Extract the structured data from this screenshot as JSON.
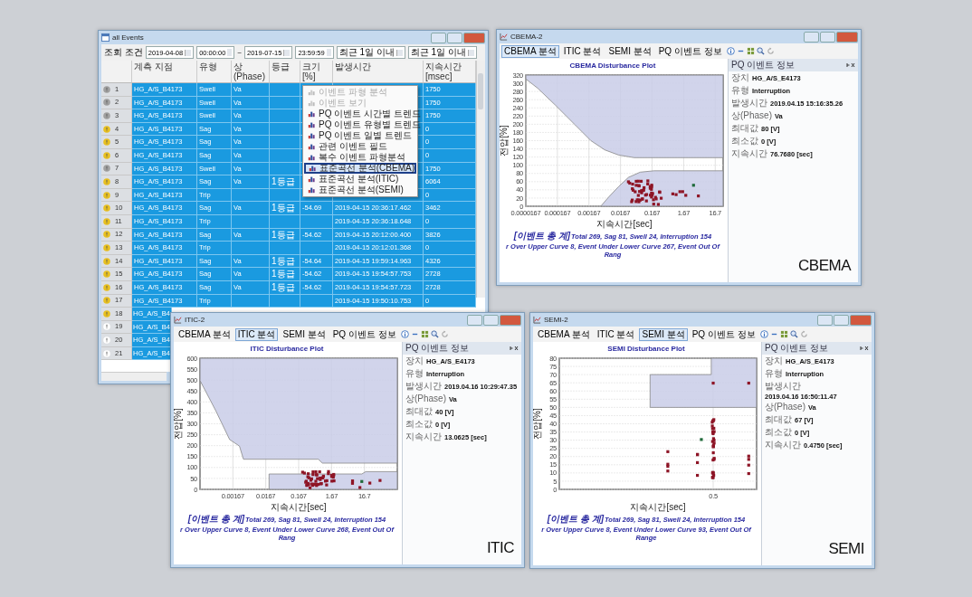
{
  "main_window": {
    "title": "all Events",
    "toolbar": {
      "label": "조회 조건",
      "start_date": "2019-04-08",
      "start_time": "00:00:00",
      "separator": "~",
      "end_date": "2019-07-15",
      "end_time": "23:59:59",
      "filter_1": "최근 1일 이내",
      "filter_2": "최근 1일 이내"
    },
    "columns": [
      "계측 지점",
      "유형",
      "상(Phase)",
      "등급",
      "크기[%]",
      "발생시간",
      "지속시간[msec]"
    ],
    "rows": [
      {
        "num": "1",
        "name": "HG_A/S_B4173",
        "type": "Swell",
        "phase": "Va",
        "grade": "",
        "size": "",
        "time": "",
        "duration": "1750",
        "color": "#a0a0a0"
      },
      {
        "num": "2",
        "name": "HG_A/S_B4173",
        "type": "Swell",
        "phase": "Va",
        "grade": "",
        "size": "",
        "time": "",
        "duration": "1750",
        "color": "#a0a0a0"
      },
      {
        "num": "3",
        "name": "HG_A/S_B4173",
        "type": "Swell",
        "phase": "Va",
        "grade": "",
        "size": "",
        "time": "",
        "duration": "1750",
        "color": "#a0a0a0"
      },
      {
        "num": "4",
        "name": "HG_A/S_B4173",
        "type": "Sag",
        "phase": "Va",
        "grade": "",
        "size": "",
        "time": "",
        "duration": "0",
        "color": "#e8c020"
      },
      {
        "num": "5",
        "name": "HG_A/S_B4173",
        "type": "Sag",
        "phase": "Va",
        "grade": "",
        "size": "",
        "time": "",
        "duration": "0",
        "color": "#e8c020"
      },
      {
        "num": "6",
        "name": "HG_A/S_B4173",
        "type": "Sag",
        "phase": "Va",
        "grade": "",
        "size": "",
        "time": "",
        "duration": "0",
        "color": "#e8c020"
      },
      {
        "num": "7",
        "name": "HG_A/S_B4173",
        "type": "Swell",
        "phase": "Va",
        "grade": "",
        "size": "",
        "time": "",
        "duration": "1750",
        "color": "#a0a0a0"
      },
      {
        "num": "8",
        "name": "HG_A/S_B4173",
        "type": "Sag",
        "phase": "Va",
        "grade": "1등급",
        "size": "",
        "time": "",
        "duration": "6064",
        "color": "#e8c020"
      },
      {
        "num": "9",
        "name": "HG_A/S_B4173",
        "type": "Trip",
        "phase": "",
        "grade": "",
        "size": "",
        "time": "",
        "duration": "0",
        "color": "#e8c020"
      },
      {
        "num": "10",
        "name": "HG_A/S_B4173",
        "type": "Sag",
        "phase": "Va",
        "grade": "1등급",
        "size": "-54.69",
        "time": "2019-04-15 20:36:17.462",
        "duration": "3462",
        "color": "#e8c020"
      },
      {
        "num": "11",
        "name": "HG_A/S_B4173",
        "type": "Trip",
        "phase": "",
        "grade": "",
        "size": "",
        "time": "2019-04-15 20:36:18.648",
        "duration": "0",
        "color": "#e8c020"
      },
      {
        "num": "12",
        "name": "HG_A/S_B4173",
        "type": "Sag",
        "phase": "Va",
        "grade": "1등급",
        "size": "-54.62",
        "time": "2019-04-15 20:12:00.400",
        "duration": "3826",
        "color": "#e8c020"
      },
      {
        "num": "13",
        "name": "HG_A/S_B4173",
        "type": "Trip",
        "phase": "",
        "grade": "",
        "size": "",
        "time": "2019-04-15 20:12:01.368",
        "duration": "0",
        "color": "#e8c020"
      },
      {
        "num": "14",
        "name": "HG_A/S_B4173",
        "type": "Sag",
        "phase": "Va",
        "grade": "1등급",
        "size": "-54.64",
        "time": "2019-04-15 19:59:14.963",
        "duration": "4326",
        "color": "#e8c020"
      },
      {
        "num": "15",
        "name": "HG_A/S_B4173",
        "type": "Sag",
        "phase": "Va",
        "grade": "1등급",
        "size": "-54.62",
        "time": "2019-04-15 19:54:57.753",
        "duration": "2728",
        "color": "#e8c020"
      },
      {
        "num": "16",
        "name": "HG_A/S_B4173",
        "type": "Sag",
        "phase": "Va",
        "grade": "1등급",
        "size": "-54.62",
        "time": "2019-04-15 19:54:57.723",
        "duration": "2728",
        "color": "#e8c020"
      },
      {
        "num": "17",
        "name": "HG_A/S_B4173",
        "type": "Trip",
        "phase": "",
        "grade": "",
        "size": "",
        "time": "2019-04-15 19:50:10.753",
        "duration": "0",
        "color": "#e8c020"
      },
      {
        "num": "18",
        "name": "HG_A/S_B4",
        "color": "#e8c020"
      },
      {
        "num": "19",
        "name": "HG_A/S_B4",
        "color": "#ffffff"
      },
      {
        "num": "20",
        "name": "HG_A/S_B4",
        "color": "#ffffff"
      },
      {
        "num": "21",
        "name": "HG_A/S_B4",
        "color": "#ffffff"
      }
    ],
    "context_menu": [
      {
        "label": "이벤트 파형 분석",
        "disabled": true,
        "selected": false
      },
      {
        "label": "이벤트 보기",
        "disabled": true,
        "selected": false
      },
      {
        "label": "PQ 이벤트 시간별 트렌드",
        "disabled": false,
        "selected": false
      },
      {
        "label": "PQ 이벤트 유형별 트렌드",
        "disabled": false,
        "selected": false
      },
      {
        "label": "PQ 이벤트 일별 트렌드",
        "disabled": false,
        "selected": false
      },
      {
        "label": "관련 이벤트 필드",
        "disabled": false,
        "selected": false
      },
      {
        "label": "복수 이벤트 파형분석",
        "disabled": false,
        "selected": false
      },
      {
        "label": "표준곡선 분석(CBEMA)",
        "disabled": false,
        "selected": true
      },
      {
        "label": "표준곡선 분석(ITIC)",
        "disabled": false,
        "selected": false
      },
      {
        "label": "표준곡선 분석(SEMI)",
        "disabled": false,
        "selected": false
      }
    ]
  },
  "plot_windows": [
    {
      "kind": "cbema",
      "title": "CBEMA-2",
      "tabs": [
        {
          "label": "CBEMA 분석",
          "selected": true
        },
        {
          "label": "ITIC 분석",
          "selected": false
        },
        {
          "label": "SEMI 분석",
          "selected": false
        },
        {
          "label": "PQ 이벤트 정보",
          "selected": false
        }
      ],
      "chart_title": "CBEMA Disturbance Plot",
      "y_label": "전압[%]",
      "x_label": "지속시간[sec]",
      "y_ticks": [
        "320",
        "300",
        "280",
        "260",
        "240",
        "220",
        "200",
        "180",
        "160",
        "140",
        "120",
        "100",
        "80",
        "60",
        "40",
        "20",
        "0"
      ],
      "x_ticks": [
        "0.0000167",
        "0.000167",
        "0.00167",
        "0.0167",
        "0.167",
        "1.67",
        "16.7"
      ],
      "summary_label": "[이벤트 총 계]",
      "summary": "Total 269, Sag 81, Swell 24, Interruption 154",
      "footer": "r Over Upper Curve 8, Event Under Lower Curve 267, Event Out Of Rang",
      "info_header": "PQ 이벤트 정보",
      "info": [
        {
          "label": "장치",
          "value": "HG_A/S_E4173"
        },
        {
          "label": "유형",
          "value": "Interruption"
        },
        {
          "label": "발생시간",
          "value": "2019.04.15 15:16:35.26"
        },
        {
          "label": "상(Phase)",
          "value": "Va"
        },
        {
          "label": "최대값",
          "value": "80 [V]"
        },
        {
          "label": "최소값",
          "value": "0 [V]"
        },
        {
          "label": "지속시간",
          "value": "76.7680 [sec]"
        }
      ],
      "badge": "CBEMA"
    },
    {
      "kind": "itic",
      "title": "ITIC-2",
      "tabs": [
        {
          "label": "CBEMA 분석",
          "selected": false
        },
        {
          "label": "ITIC 분석",
          "selected": true
        },
        {
          "label": "SEMI 분석",
          "selected": false
        },
        {
          "label": "PQ 이벤트 정보",
          "selected": false
        }
      ],
      "chart_title": "ITIC Disturbance Plot",
      "y_label": "전압[%]",
      "x_label": "지속시간[sec]",
      "y_ticks": [
        "600",
        "550",
        "500",
        "450",
        "400",
        "350",
        "300",
        "250",
        "200",
        "150",
        "100",
        "50",
        "0"
      ],
      "x_ticks": [
        "0.00167",
        "0.0167",
        "0.167",
        "1.67",
        "16.7"
      ],
      "summary_label": "[이벤트 총 계]",
      "summary": "Total 269, Sag 81, Swell 24, Interruption 154",
      "footer": "r Over Upper Curve 8, Event Under Lower Curve 268, Event Out Of Rang",
      "info_header": "PQ 이벤트 정보",
      "info": [
        {
          "label": "장치",
          "value": "HG_A/S_E4173"
        },
        {
          "label": "유형",
          "value": "Interruption"
        },
        {
          "label": "발생시간",
          "value": "2019.04.16 10:29:47.35"
        },
        {
          "label": "상(Phase)",
          "value": "Va"
        },
        {
          "label": "최대값",
          "value": "40 [V]"
        },
        {
          "label": "최소값",
          "value": "0 [V]"
        },
        {
          "label": "지속시간",
          "value": "13.0625 [sec]"
        }
      ],
      "badge": "ITIC"
    },
    {
      "kind": "semi",
      "title": "SEMI-2",
      "tabs": [
        {
          "label": "CBEMA 분석",
          "selected": false
        },
        {
          "label": "ITIC 분석",
          "selected": false
        },
        {
          "label": "SEMI 분석",
          "selected": true
        },
        {
          "label": "PQ 이벤트 정보",
          "selected": false
        }
      ],
      "chart_title": "SEMI Disturbance Plot",
      "y_label": "전압[%]",
      "x_label": "지속시간[sec]",
      "y_ticks": [
        "80",
        "75",
        "70",
        "65",
        "60",
        "55",
        "50",
        "45",
        "40",
        "35",
        "30",
        "25",
        "20",
        "15",
        "10",
        "5",
        "0"
      ],
      "x_ticks": [
        "0.5"
      ],
      "summary_label": "[이벤트 총 계]",
      "summary": "Total 269, Sag 81, Swell 24, Interruption 154",
      "footer": "r Over Upper Curve 8, Event Under Lower Curve 93, Event Out Of Range",
      "info_header": "PQ 이벤트 정보",
      "info": [
        {
          "label": "장치",
          "value": "HG_A/S_E4173"
        },
        {
          "label": "유형",
          "value": "Interruption"
        },
        {
          "label": "발생시간",
          "value": "2019.04.16 16:50:11.47"
        },
        {
          "label": "상(Phase)",
          "value": "Va"
        },
        {
          "label": "최대값",
          "value": "67 [V]"
        },
        {
          "label": "최소값",
          "value": "0 [V]"
        },
        {
          "label": "지속시간",
          "value": "0.4750 [sec]"
        }
      ],
      "badge": "SEMI"
    }
  ]
}
